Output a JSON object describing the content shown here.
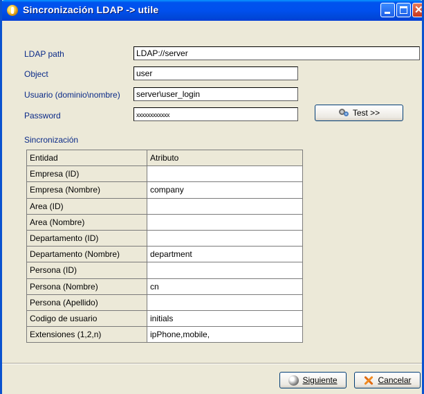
{
  "window": {
    "title": "Sincronización LDAP -> utile"
  },
  "form": {
    "ldap_path_label": "LDAP path",
    "ldap_path_value": "LDAP://server",
    "object_label": "Object",
    "object_value": "user",
    "usuario_label": "Usuario (dominio\\nombre)",
    "usuario_value": "server\\user_login",
    "password_label": "Password",
    "password_value": "xxxxxxxxxxxx",
    "test_button": "Test >>"
  },
  "sync": {
    "section_label": "Sincronización",
    "headers": {
      "entidad": "Entidad",
      "atributo": "Atributo"
    },
    "rows": [
      {
        "entidad": "Empresa (ID)",
        "atributo": ""
      },
      {
        "entidad": "Empresa (Nombre)",
        "atributo": "company"
      },
      {
        "entidad": "Area (ID)",
        "atributo": ""
      },
      {
        "entidad": "Area (Nombre)",
        "atributo": ""
      },
      {
        "entidad": "Departamento (ID)",
        "atributo": ""
      },
      {
        "entidad": "Departamento (Nombre)",
        "atributo": "department"
      },
      {
        "entidad": "Persona (ID)",
        "atributo": ""
      },
      {
        "entidad": "Persona (Nombre)",
        "atributo": "cn"
      },
      {
        "entidad": "Persona (Apellido)",
        "atributo": ""
      },
      {
        "entidad": "Codigo de usuario",
        "atributo": "initials"
      },
      {
        "entidad": "Extensiones (1,2,n)",
        "atributo": "ipPhone,mobile,"
      }
    ]
  },
  "footer": {
    "next_button": "Siguiente",
    "cancel_button": "Cancelar"
  }
}
